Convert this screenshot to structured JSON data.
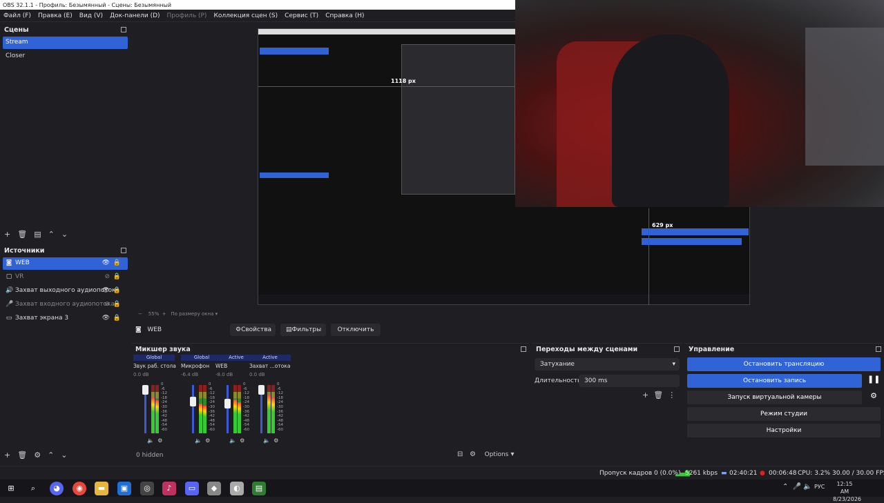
{
  "window": {
    "title": "OBS 32.1.1 - Профиль: Безымянный - Сцены: Безымянный"
  },
  "menu": [
    "Файл (F)",
    "Правка (E)",
    "Вид (V)",
    "Док-панели (D)",
    "Профиль (P)",
    "Коллекция сцен (S)",
    "Сервис (T)",
    "Справка (H)"
  ],
  "scenes": {
    "title": "Сцены",
    "items": [
      "Stream",
      "Closer"
    ],
    "selected": 0
  },
  "sources": {
    "title": "Источники",
    "items": [
      {
        "name": "WEB",
        "icon": "camera-icon",
        "visible": true,
        "selected": true
      },
      {
        "name": "VR",
        "icon": "window-icon",
        "visible": false,
        "selected": false
      },
      {
        "name": "Захват выходного аудиопотока",
        "icon": "speaker-icon",
        "visible": true,
        "selected": false
      },
      {
        "name": "Захват входного аудиопотока",
        "icon": "mic-icon",
        "visible": false,
        "selected": false
      },
      {
        "name": "Захват экрана 3",
        "icon": "monitor-icon",
        "visible": true,
        "selected": false
      }
    ]
  },
  "preview": {
    "zoom": "55%",
    "mode": "По размеру окна",
    "dim_h": "1118 px",
    "dim_v": "629 px"
  },
  "source_bar": {
    "name": "WEB",
    "properties": "Свойства",
    "filters": "Фильтры",
    "deactivate": "Отключить"
  },
  "mixer": {
    "title": "Микшер звука",
    "hidden": "0 hidden",
    "options": "Options",
    "channels": [
      {
        "badge": "Global",
        "name": "Звук раб. стола",
        "db": "0.0 dB",
        "level": 0.75,
        "slider": 1.0
      },
      {
        "badge": "Global",
        "name": "Микрофон",
        "db": "-6.4 dB",
        "level": 0.62,
        "slider": 0.7
      },
      {
        "badge": "Active",
        "name": "WEB",
        "db": "-8.0 dB",
        "level": 0.7,
        "slider": 0.65
      },
      {
        "badge": "Active",
        "name": "Захват ...отока 2",
        "db": "0.0 dB",
        "level": 0.8,
        "slider": 1.0
      }
    ],
    "scale": [
      "0",
      "-6",
      "-12",
      "-18",
      "-24",
      "-30",
      "-36",
      "-42",
      "-48",
      "-54",
      "-60"
    ]
  },
  "transitions": {
    "title": "Переходы между сценами",
    "type": "Затухание",
    "duration_label": "Длительность",
    "duration": "300 ms"
  },
  "controls": {
    "title": "Управление",
    "stop_stream": "Остановить трансляцию",
    "stop_record": "Остановить запись",
    "virtual_cam": "Запуск виртуальной камеры",
    "studio_mode": "Режим студии",
    "settings": "Настройки"
  },
  "status": {
    "dropped": "Пропуск кадров 0 (0.0%)",
    "bitrate": "5261 kbps",
    "stream_time": "02:40:21",
    "rec_time": "00:06:48",
    "cpu": "CPU: 3.2%",
    "fps": "30.00 / 30.00 FPS"
  },
  "taskbar": {
    "lang": "РУС",
    "time": "12:15 AM",
    "date": "8/23/2026"
  },
  "colors": {
    "accent": "#2f63d6",
    "bg": "#1f1f23",
    "panel": "#2a2a2f"
  }
}
